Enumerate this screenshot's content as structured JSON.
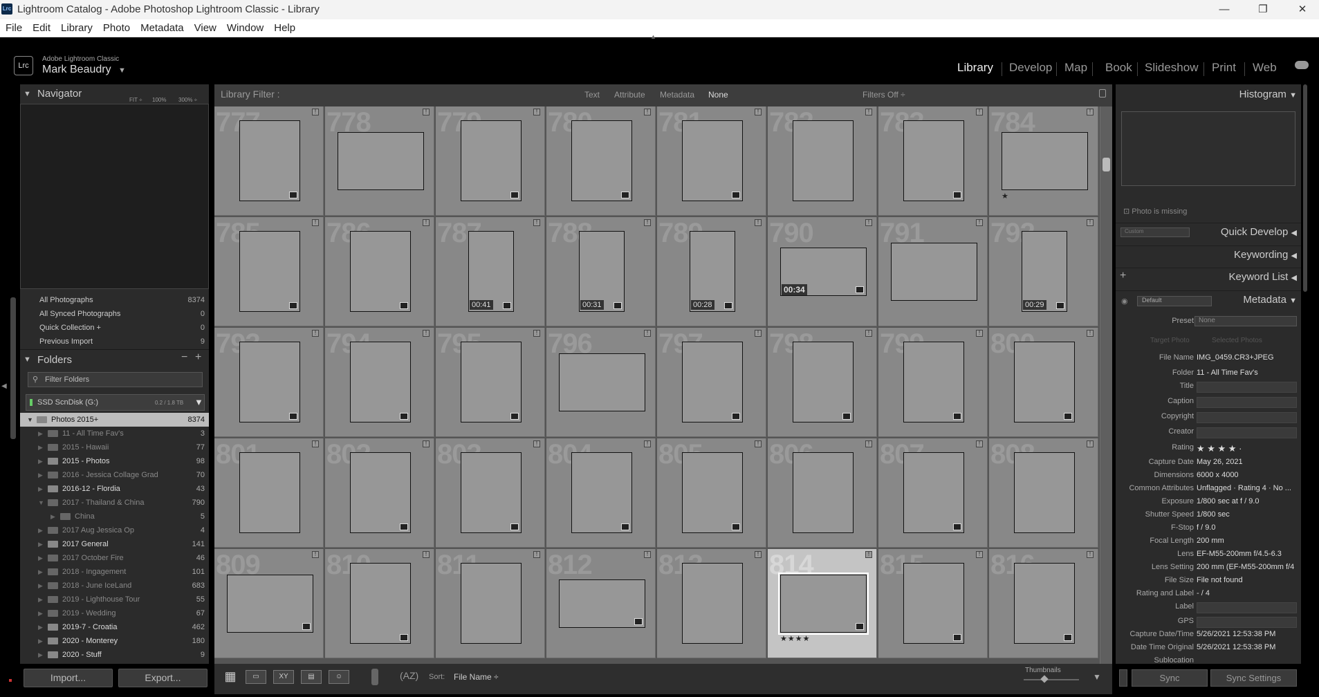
{
  "window": {
    "title": "Lightroom Catalog - Adobe Photoshop Lightroom Classic - Library",
    "logo": "Lrc",
    "minimize": "—",
    "maximize": "❐",
    "close": "✕"
  },
  "menu": [
    "File",
    "Edit",
    "Library",
    "Photo",
    "Metadata",
    "View",
    "Window",
    "Help"
  ],
  "identity": {
    "logo": "Lrc",
    "app": "Adobe Lightroom Classic",
    "user": "Mark Beaudry"
  },
  "modules": [
    "Library",
    "Develop",
    "Map",
    "Book",
    "Slideshow",
    "Print",
    "Web"
  ],
  "active_module": "Library",
  "navigator": {
    "title": "Navigator",
    "fit": "FIT ÷",
    "z1": "100%",
    "z2": "300% ÷"
  },
  "catalog": [
    {
      "label": "All Photographs",
      "count": "8374"
    },
    {
      "label": "All Synced Photographs",
      "count": "0"
    },
    {
      "label": "Quick Collection +",
      "count": "0"
    },
    {
      "label": "Previous Import",
      "count": "9"
    }
  ],
  "folders": {
    "title": "Folders",
    "filter_placeholder": "Filter Folders",
    "volume": "SSD ScnDisk (G:)",
    "volume_size": "0.2 / 1.8 TB",
    "items": [
      {
        "label": "Photos 2015+",
        "count": "8374",
        "level": 0,
        "hl": true
      },
      {
        "label": "11 - All Time Fav's",
        "count": "3",
        "level": 1,
        "missing": true
      },
      {
        "label": "2015 - Hawaii",
        "count": "77",
        "level": 1,
        "missing": true
      },
      {
        "label": "2015 - Photos",
        "count": "98",
        "level": 1
      },
      {
        "label": "2016 - Jessica Collage Grad",
        "count": "70",
        "level": 1,
        "missing": true
      },
      {
        "label": "2016-12 - Flordia",
        "count": "43",
        "level": 1
      },
      {
        "label": "2017 - Thailand & China",
        "count": "790",
        "level": 1,
        "missing": true
      },
      {
        "label": "China",
        "count": "5",
        "level": 2,
        "missing": true
      },
      {
        "label": "2017 Aug Jessica Op",
        "count": "4",
        "level": 1,
        "missing": true
      },
      {
        "label": "2017 General",
        "count": "141",
        "level": 1
      },
      {
        "label": "2017 October Fire",
        "count": "46",
        "level": 1,
        "missing": true
      },
      {
        "label": "2018 - Ingagement",
        "count": "101",
        "level": 1,
        "missing": true
      },
      {
        "label": "2018 - June IceLand",
        "count": "683",
        "level": 1,
        "missing": true
      },
      {
        "label": "2019 - Lighthouse Tour",
        "count": "55",
        "level": 1,
        "missing": true
      },
      {
        "label": "2019 - Wedding",
        "count": "67",
        "level": 1,
        "missing": true
      },
      {
        "label": "2019-7 - Croatia",
        "count": "462",
        "level": 1
      },
      {
        "label": "2020 - Monterey",
        "count": "180",
        "level": 1
      },
      {
        "label": "2020 - Stuff",
        "count": "9",
        "level": 1
      }
    ]
  },
  "buttons": {
    "import": "Import...",
    "export": "Export..."
  },
  "filter": {
    "title": "Library Filter :",
    "tabs": [
      "Text",
      "Attribute",
      "Metadata",
      "None"
    ],
    "filters_off": "Filters Off ÷"
  },
  "grid": {
    "cells": [
      {
        "n": "777",
        "o": "p",
        "b": true
      },
      {
        "n": "778",
        "o": "l"
      },
      {
        "n": "779",
        "o": "p",
        "b": true
      },
      {
        "n": "780",
        "o": "p",
        "b": true
      },
      {
        "n": "781",
        "o": "p",
        "b": true
      },
      {
        "n": "782",
        "o": "p"
      },
      {
        "n": "783",
        "o": "p",
        "b": true
      },
      {
        "n": "784",
        "o": "l",
        "s": "★"
      },
      {
        "n": "785",
        "o": "p",
        "b": true
      },
      {
        "n": "786",
        "o": "p",
        "b": true
      },
      {
        "n": "787",
        "o": "n",
        "b": true,
        "d": "00:41"
      },
      {
        "n": "788",
        "o": "n",
        "b": true,
        "d": "00:31"
      },
      {
        "n": "789",
        "o": "n",
        "b": true,
        "d": "00:28"
      },
      {
        "n": "790",
        "o": "w",
        "b": true,
        "d": "00:34"
      },
      {
        "n": "791",
        "o": "l"
      },
      {
        "n": "792",
        "o": "n",
        "b": true,
        "d": "00:29"
      },
      {
        "n": "793",
        "o": "p",
        "b": true
      },
      {
        "n": "794",
        "o": "p",
        "b": true
      },
      {
        "n": "795",
        "o": "p",
        "b": true
      },
      {
        "n": "796",
        "o": "l"
      },
      {
        "n": "797",
        "o": "p",
        "b": true
      },
      {
        "n": "798",
        "o": "p",
        "b": true
      },
      {
        "n": "799",
        "o": "p",
        "b": true
      },
      {
        "n": "800",
        "o": "p",
        "b": true
      },
      {
        "n": "801",
        "o": "p"
      },
      {
        "n": "802",
        "o": "p",
        "b": true
      },
      {
        "n": "803",
        "o": "p",
        "b": true
      },
      {
        "n": "804",
        "o": "p",
        "b": true
      },
      {
        "n": "805",
        "o": "p",
        "b": true
      },
      {
        "n": "806",
        "o": "p"
      },
      {
        "n": "807",
        "o": "p",
        "b": true
      },
      {
        "n": "808",
        "o": "p"
      },
      {
        "n": "809",
        "o": "l",
        "b": true
      },
      {
        "n": "810",
        "o": "p",
        "b": true
      },
      {
        "n": "811",
        "o": "p"
      },
      {
        "n": "812",
        "o": "w",
        "b": true
      },
      {
        "n": "813",
        "o": "p"
      },
      {
        "n": "814",
        "o": "l",
        "b": true,
        "sel": true,
        "s": "★★★★"
      },
      {
        "n": "815",
        "o": "p",
        "b": true
      },
      {
        "n": "816",
        "o": "p",
        "b": true
      }
    ]
  },
  "toolbar": {
    "sort_label": "Sort:",
    "sort_value": "File Name ÷",
    "thumbnails": "Thumbnails"
  },
  "right": {
    "histogram": "Histogram",
    "photo_missing": "Photo is missing",
    "quick_develop": "Quick Develop",
    "keywording": "Keywording",
    "keyword_list": "Keyword List",
    "metadata": "Metadata",
    "default": "Default",
    "custom": "Custom",
    "preset_label": "Preset",
    "preset_value": "None",
    "target_photo": "Target Photo",
    "selected_photos": "Selected Photos"
  },
  "metadata_fields": [
    {
      "k": "File Name",
      "v": "IMG_0459.CR3+JPEG"
    },
    {
      "k": "Folder",
      "v": "11 - All Time Fav's"
    },
    {
      "k": "Title",
      "v": "",
      "box": true
    },
    {
      "k": "Caption",
      "v": "",
      "box": true
    },
    {
      "k": "Copyright",
      "v": "",
      "box": true
    },
    {
      "k": "Creator",
      "v": "",
      "box": true
    },
    {
      "k": "Rating",
      "v": "★ ★ ★ ★ ·"
    },
    {
      "k": "Capture Date",
      "v": "May 26, 2021"
    },
    {
      "k": "Dimensions",
      "v": "6000 x 4000"
    },
    {
      "k": "Common Attributes",
      "v": "Unflagged · Rating 4 · No ..."
    },
    {
      "k": "Exposure",
      "v": "1/800 sec at f / 9.0"
    },
    {
      "k": "Shutter Speed",
      "v": "1/800 sec"
    },
    {
      "k": "F-Stop",
      "v": "f / 9.0"
    },
    {
      "k": "Focal Length",
      "v": "200 mm"
    },
    {
      "k": "Lens",
      "v": "EF-M55-200mm f/4.5-6.3"
    },
    {
      "k": "Lens Setting",
      "v": "200 mm (EF-M55-200mm f/4"
    },
    {
      "k": "File Size",
      "v": "File not found"
    },
    {
      "k": "Rating and Label",
      "v": "- / 4"
    },
    {
      "k": "Label",
      "v": "",
      "box": true
    },
    {
      "k": "GPS",
      "v": "",
      "box": true
    },
    {
      "k": "Capture Date/Time",
      "v": "5/26/2021 12:53:38 PM"
    },
    {
      "k": "Date Time Original",
      "v": "5/26/2021 12:53:38 PM"
    },
    {
      "k": "Sublocation",
      "v": ""
    }
  ],
  "sync": {
    "sync": "Sync",
    "sync_settings": "Sync Settings"
  }
}
